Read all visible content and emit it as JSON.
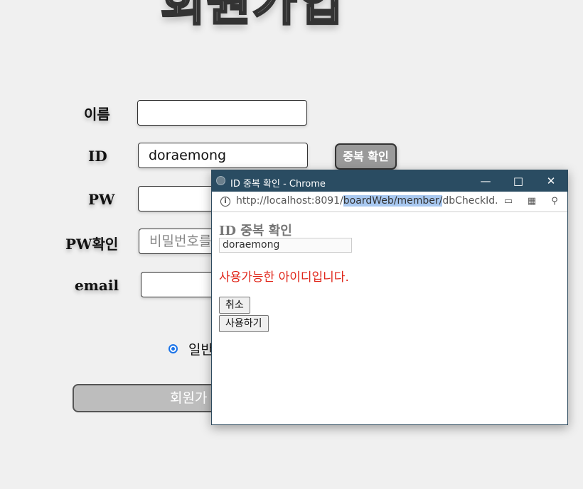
{
  "page": {
    "title": "회원가입",
    "form": {
      "name_label": "이름",
      "name_value": "",
      "id_label": "ID",
      "id_value": "doraemong",
      "dup_check_button": "중복 확인",
      "pw_label": "PW",
      "pw_confirm_label": "PW확인",
      "pw_confirm_placeholder": "비밀번호를",
      "email_label": "email",
      "radio_label": "일반",
      "signup_button": "회원가"
    }
  },
  "popup": {
    "window_title": "ID 중복 확인 - Chrome",
    "url_prefix": "http://localhost:8091/",
    "url_selected": "boardWeb/member/",
    "url_suffix": "dbCheckId.do?u",
    "heading": "ID 중복 확인",
    "id_value": "doraemong",
    "message": "사용가능한 아이디입니다.",
    "cancel_button": "취소",
    "use_button": "사용하기",
    "message_color": "#e0261a"
  }
}
